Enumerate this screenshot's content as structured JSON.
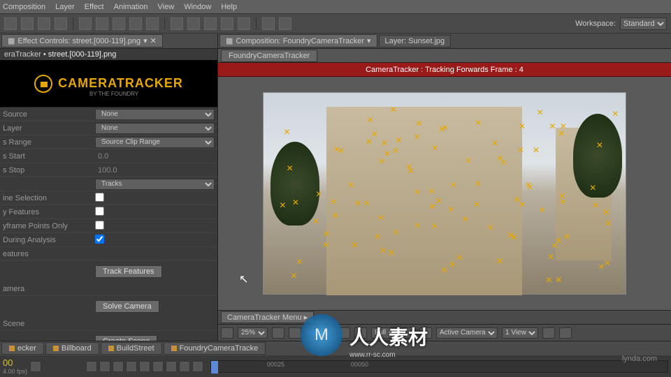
{
  "menu": {
    "items": [
      "Composition",
      "Layer",
      "Effect",
      "Animation",
      "View",
      "Window",
      "Help"
    ]
  },
  "workspace": {
    "label": "Workspace:",
    "value": "Standard"
  },
  "leftPanel": {
    "tab": "Effect Controls: street.[000-119].png",
    "crumb_a": "eraTracker",
    "crumb_b": "street.[000-119].png",
    "logo_main": "CAMERATRACKER",
    "logo_sub": "BY THE FOUNDRY",
    "rows": [
      {
        "label": "Source",
        "type": "select",
        "value": "None"
      },
      {
        "label": "Layer",
        "type": "select",
        "value": "None"
      },
      {
        "label": "s Range",
        "type": "select",
        "value": "Source Clip Range"
      },
      {
        "label": "s Start",
        "type": "num",
        "value": "0.0"
      },
      {
        "label": "s Stop",
        "type": "num",
        "value": "100.0"
      },
      {
        "label": "",
        "type": "select",
        "value": "Tracks"
      },
      {
        "label": "ine Selection",
        "type": "check",
        "value": false
      },
      {
        "label": "y Features",
        "type": "check",
        "value": false
      },
      {
        "label": "yframe Points Only",
        "type": "check",
        "value": false
      },
      {
        "label": "During Analysis",
        "type": "check",
        "value": true
      }
    ],
    "sections": [
      {
        "label": "eatures",
        "button": "Track Features"
      },
      {
        "label": "amera",
        "button": "Solve Camera"
      },
      {
        "label": "Scene",
        "button": "Create Scene"
      }
    ]
  },
  "rightPanel": {
    "tabs": [
      {
        "label": "Composition: FoundryCameraTracker",
        "active": true
      },
      {
        "label": "Layer: Sunset.jpg",
        "active": false
      }
    ],
    "subtab": "FoundryCameraTracker",
    "banner": "CameraTracker : Tracking Forwards Frame : 4",
    "menuBtn": "CameraTracker Menu",
    "ctrl": {
      "zoom": "25%",
      "frame": "00004",
      "res": "Full",
      "cam": "Active Camera",
      "view": "1 View"
    }
  },
  "bottom": {
    "tabs": [
      "ecker",
      "Billboard",
      "BuildStreet",
      "FoundryCameraTracke"
    ],
    "timecode": "00",
    "fps": "4.00 fps)",
    "ticks": [
      "00025",
      "00050"
    ]
  },
  "watermark": {
    "text": "lynda.com",
    "cjk": "人人素材",
    "url": "www.rr-sc.com"
  }
}
